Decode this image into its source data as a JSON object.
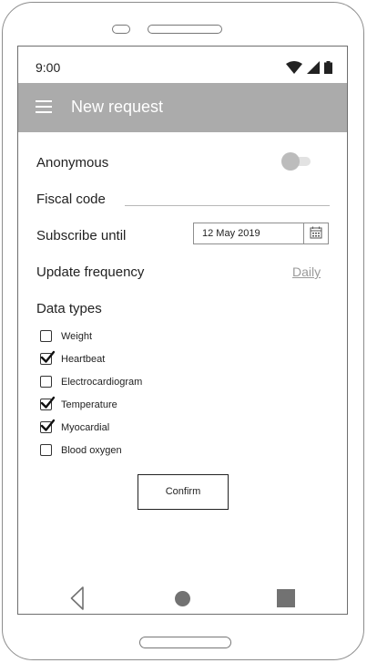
{
  "status": {
    "time": "9:00",
    "icons": [
      "wifi-icon",
      "signal-icon",
      "battery-icon"
    ]
  },
  "appbar": {
    "title": "New request",
    "menu_icon": "hamburger-menu-icon"
  },
  "form": {
    "anonymous_label": "Anonymous",
    "anonymous_on": false,
    "fiscal_label": "Fiscal code",
    "fiscal_value": "",
    "subscribe_label": "Subscribe until",
    "subscribe_date": "12 May 2019",
    "calendar_icon": "calendar-icon",
    "frequency_label": "Update frequency",
    "frequency_value": "Daily",
    "data_types_label": "Data types",
    "data_types": [
      {
        "label": "Weight",
        "checked": false
      },
      {
        "label": "Heartbeat",
        "checked": true
      },
      {
        "label": "Electrocardiogram",
        "checked": false
      },
      {
        "label": "Temperature",
        "checked": true
      },
      {
        "label": "Myocardial",
        "checked": true
      },
      {
        "label": "Blood oxygen",
        "checked": false
      }
    ],
    "confirm_label": "Confirm"
  },
  "navbar": {
    "back_icon": "back-triangle-icon",
    "home_icon": "home-circle-icon",
    "recent_icon": "recent-square-icon"
  },
  "colors": {
    "appbar": "#ababab",
    "toggle_knob": "#bcbcbc",
    "link": "#9a9a9a",
    "nav_icons": "#727272"
  }
}
